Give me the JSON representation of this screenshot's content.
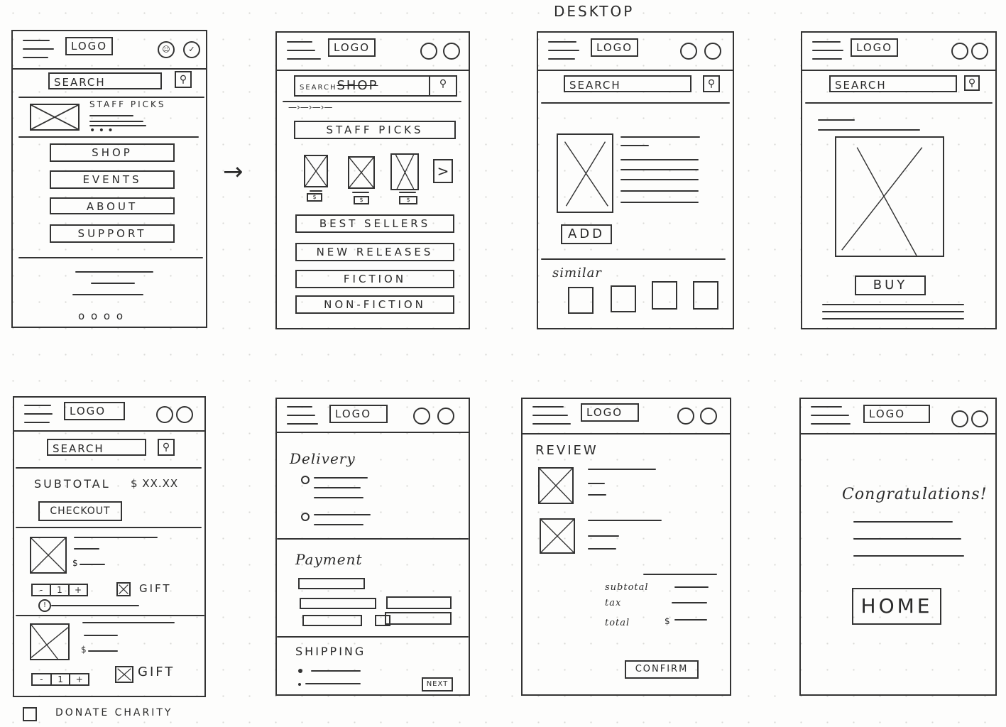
{
  "title": "DESKTOP",
  "flow_arrow": "→",
  "common": {
    "logo": "LOGO",
    "search": "SEARCH",
    "search_icon": "⚲"
  },
  "screens": {
    "home": {
      "user_icon": "☺",
      "cart_icon": "✓",
      "staff_picks": "STAFF PICKS",
      "more_dots": "• • •",
      "menu": [
        "SHOP",
        "EVENTS",
        "ABOUT",
        "SUPPORT"
      ],
      "pager": "o o o o"
    },
    "shop": {
      "search_value": "SEARCH",
      "struck_text": "SHOP",
      "breadcrumb": "—›—›—›—",
      "staff_picks": "STAFF PICKS",
      "next_icon": ">",
      "price_tag": "$",
      "categories": [
        "BEST SELLERS",
        "NEW RELEASES",
        "FICTION",
        "NON-FICTION"
      ]
    },
    "product": {
      "add": "ADD",
      "similar": "similar"
    },
    "detail": {
      "buy": "BUY"
    },
    "cart": {
      "subtotal_label": "SUBTOTAL",
      "subtotal_value": "$ XX.XX",
      "checkout": "CHECKOUT",
      "items": [
        {
          "qty": "1",
          "minus": "-",
          "plus": "+",
          "gift": "GIFT",
          "gift_checked": true,
          "price_sign": "$",
          "warning_icon": "!"
        },
        {
          "qty": "1",
          "minus": "-",
          "plus": "+",
          "gift": "GIFT",
          "gift_checked": true,
          "price_sign": "$"
        }
      ],
      "donate": "DONATE CHARITY"
    },
    "checkout": {
      "delivery": "Delivery",
      "payment": "Payment",
      "shipping": "SHIPPING",
      "next": "NEXT"
    },
    "review": {
      "title": "REVIEW",
      "subtotal": "subtotal",
      "tax": "tax",
      "total": "total",
      "total_sign": "$",
      "confirm": "CONFIRM"
    },
    "confirmation": {
      "message": "Congratulations!",
      "home": "HOME"
    }
  }
}
